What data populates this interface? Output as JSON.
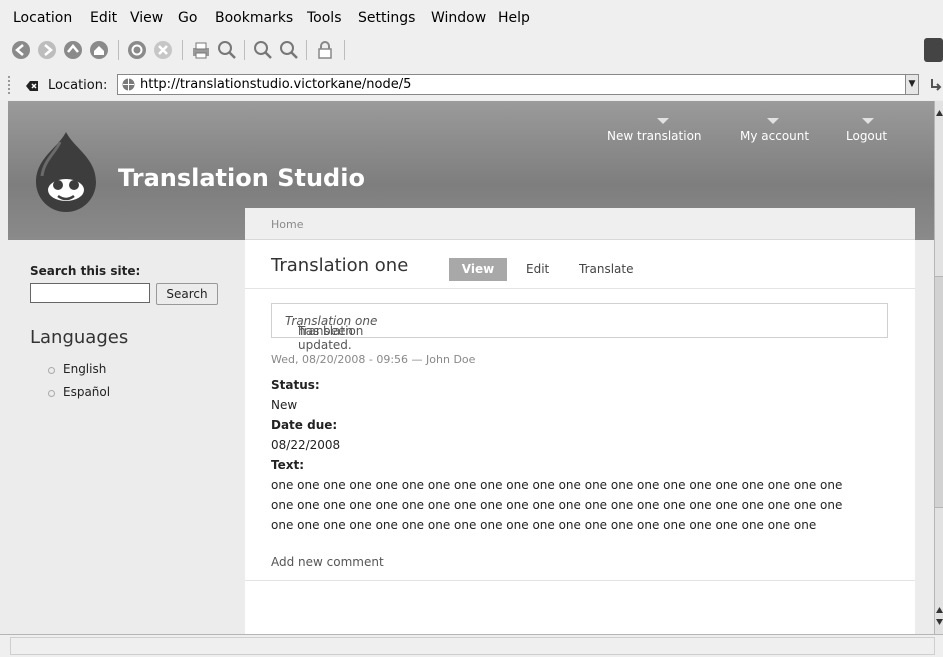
{
  "menu": [
    "Location",
    "Edit",
    "View",
    "Go",
    "Bookmarks",
    "Tools",
    "Settings",
    "Window",
    "Help"
  ],
  "toolbar_icons": [
    "back-icon",
    "forward-icon",
    "up-icon",
    "home-icon",
    "reload-icon",
    "stop-icon",
    "print-icon",
    "find-icon",
    "zoom-in-icon",
    "zoom-out-icon",
    "security-lock-icon"
  ],
  "location": {
    "label": "Location:",
    "url": "http://translationstudio.victorkane/node/5"
  },
  "site": {
    "name": "Translation Studio",
    "nav": [
      "New translation",
      "My account",
      "Logout"
    ]
  },
  "sidebar": {
    "search_title": "Search this site:",
    "search_value": "",
    "search_button": "Search",
    "languages_title": "Languages",
    "languages": [
      "English",
      "Español"
    ]
  },
  "main": {
    "breadcrumb": "Home",
    "title": "Translation one",
    "tabs": [
      "View",
      "Edit",
      "Translate"
    ],
    "message_prefix": "Translation ",
    "message_em": "Translation one",
    "message_suffix": " has been updated.",
    "submitted": "Wed, 08/20/2008 - 09:56 — John Doe",
    "status_label": "Status:",
    "status_value": "New",
    "date_label": "Date due:",
    "date_value": "08/22/2008",
    "text_label": "Text:",
    "text_lines": [
      "one one one one one one one one one one one one one one one one one one one one one one",
      "one one one one one one one one one one one one one one one one one one one one one one",
      "one one one one one one one one one one one one one one one one one one one one one"
    ],
    "add_comment": "Add new comment"
  },
  "colors": {
    "header_gradient_top": "#9a9a9a",
    "header_gradient_bottom": "#7e7e7e",
    "view_tab_bg": "#a8a8a8"
  }
}
